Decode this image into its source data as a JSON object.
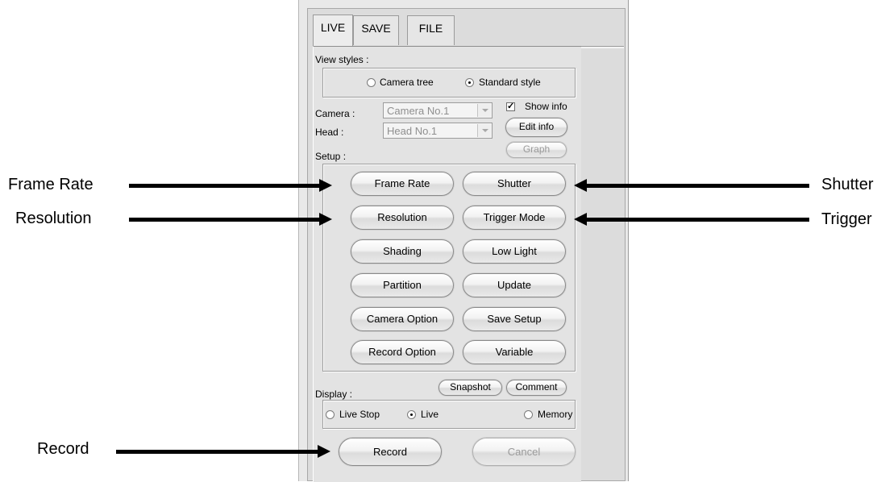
{
  "tabs": [
    {
      "label": "LIVE"
    },
    {
      "label": "SAVE"
    },
    {
      "label": "FILE"
    }
  ],
  "view_styles": {
    "label": "View styles :",
    "options": [
      {
        "label": "Camera tree",
        "selected": false
      },
      {
        "label": "Standard style",
        "selected": true
      }
    ]
  },
  "camera": {
    "label": "Camera :",
    "value": "Camera No.1"
  },
  "head": {
    "label": "Head :",
    "value": "Head No.1"
  },
  "show_info": {
    "label": "Show info",
    "checked": true
  },
  "edit_info_label": "Edit info",
  "graph_label": "Graph",
  "setup": {
    "label": "Setup :",
    "buttons": [
      "Frame Rate",
      "Shutter",
      "Resolution",
      "Trigger Mode",
      "Shading",
      "Low Light",
      "Partition",
      "Update",
      "Camera Option",
      "Save Setup",
      "Record Option",
      "Variable"
    ]
  },
  "display": {
    "label": "Display :",
    "snapshot_label": "Snapshot",
    "comment_label": "Comment",
    "options": [
      {
        "label": "Live Stop",
        "selected": false
      },
      {
        "label": "Live",
        "selected": true
      },
      {
        "label": "Memory",
        "selected": false
      }
    ]
  },
  "record_label": "Record",
  "cancel_label": "Cancel",
  "annotations": {
    "frame_rate": "Frame Rate",
    "resolution": "Resolution",
    "record": "Record",
    "shutter": "Shutter",
    "trigger": "Trigger"
  }
}
